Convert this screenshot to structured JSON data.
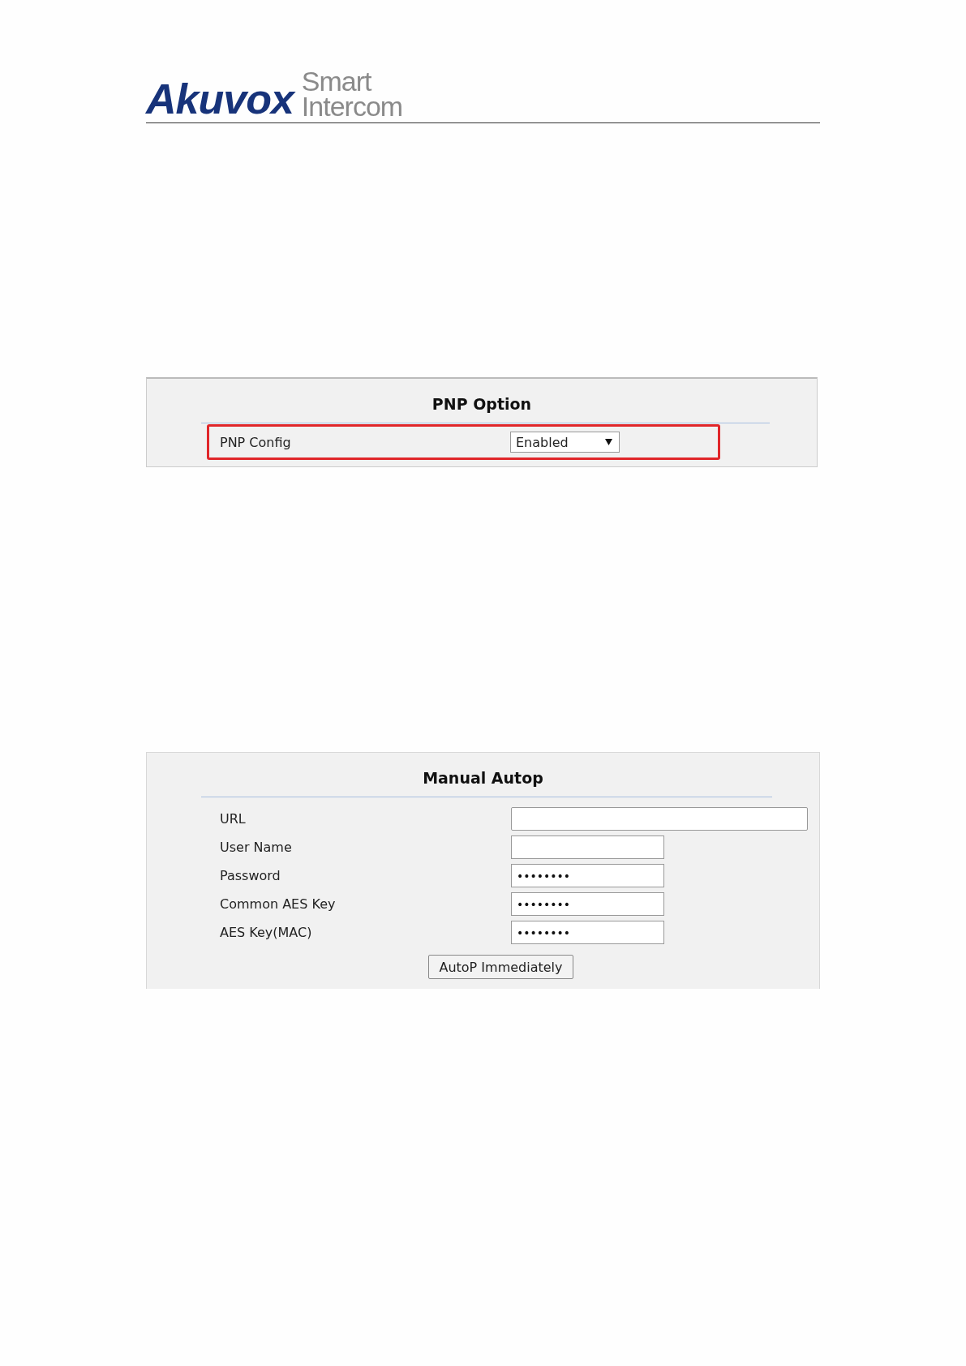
{
  "header": {
    "logo_brand": "Akuvox",
    "logo_tagline_1": "Smart",
    "logo_tagline_2": "Intercom"
  },
  "pnp_panel": {
    "title": "PNP Option",
    "rows": [
      {
        "label": "PNP Config",
        "value": "Enabled",
        "kind": "select",
        "highlighted": true
      }
    ]
  },
  "autop_panel": {
    "title": "Manual Autop",
    "fields": [
      {
        "label": "URL",
        "kind": "wide"
      },
      {
        "label": "User Name",
        "kind": "narrow"
      },
      {
        "label": "Password",
        "value": "••••••••",
        "kind": "narrow"
      },
      {
        "label": "Common AES Key",
        "value": "••••••••",
        "kind": "narrow"
      },
      {
        "label": "AES Key(MAC)",
        "value": "••••••••",
        "kind": "narrow"
      }
    ],
    "button": "AutoP Immediately"
  }
}
